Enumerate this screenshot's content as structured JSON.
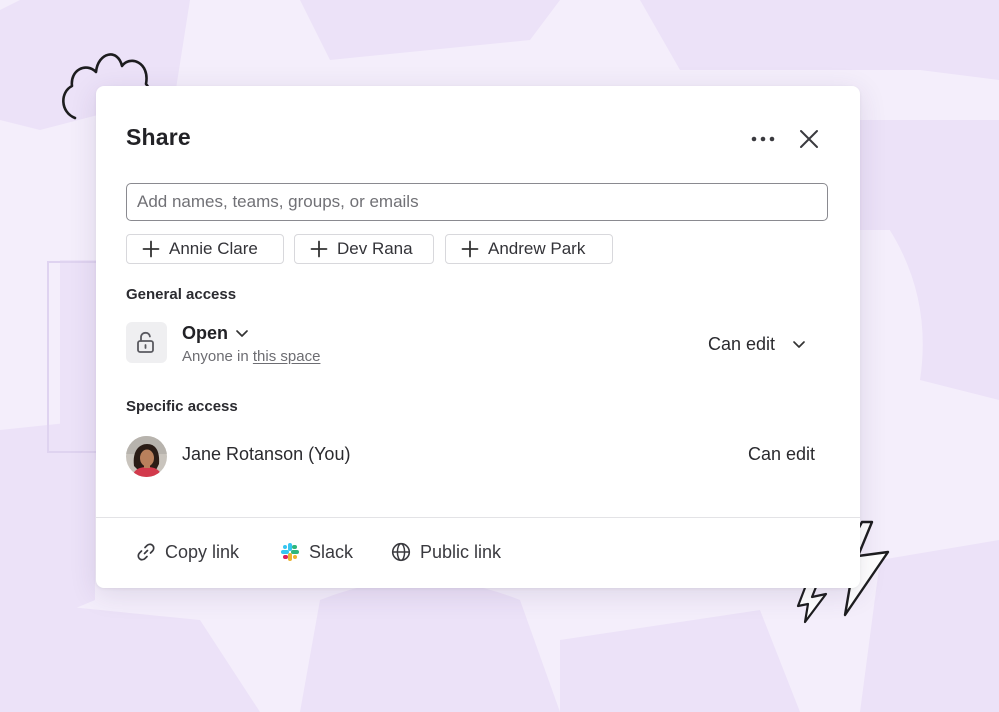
{
  "dialog": {
    "title": "Share"
  },
  "search": {
    "placeholder": "Add names, teams, groups, or emails",
    "value": ""
  },
  "suggestions": [
    {
      "label": "Annie Clare"
    },
    {
      "label": "Dev Rana"
    },
    {
      "label": "Andrew Park"
    }
  ],
  "general_access": {
    "heading": "General access",
    "type": "Open",
    "description_prefix": "Anyone in",
    "description_link": "this space",
    "permission": "Can edit"
  },
  "specific_access": {
    "heading": "Specific access",
    "people": [
      {
        "name": "Jane Rotanson (You)",
        "permission": "Can edit"
      }
    ]
  },
  "footer": {
    "copy_link": "Copy link",
    "slack": "Slack",
    "public_link": "Public link"
  },
  "icons": {
    "more": "more-horizontal-icon",
    "close": "close-icon",
    "add": "plus-icon",
    "lock": "unlock-icon",
    "chevron": "chevron-down-icon",
    "link": "link-icon",
    "slack": "slack-icon",
    "globe": "globe-icon"
  },
  "colors": {
    "background": "#f4eefb",
    "background_shapes": "#eadff7",
    "dialog": "#ffffff",
    "text": "#222226",
    "border": "#8a8a90"
  }
}
